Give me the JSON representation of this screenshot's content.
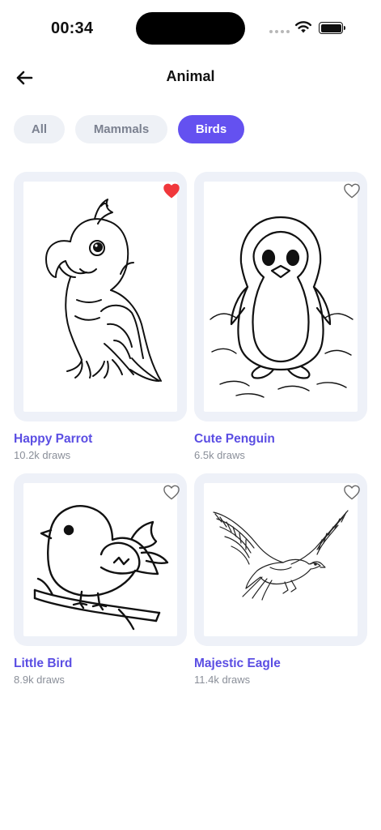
{
  "status": {
    "time": "00:34"
  },
  "header": {
    "title": "Animal"
  },
  "chips": [
    {
      "label": "All",
      "selected": false
    },
    {
      "label": "Mammals",
      "selected": false
    },
    {
      "label": "Birds",
      "selected": true
    }
  ],
  "cards": [
    {
      "title": "Happy Parrot",
      "draws": "10.2k draws",
      "favorite": true
    },
    {
      "title": "Cute Penguin",
      "draws": "6.5k draws",
      "favorite": false
    },
    {
      "title": "Little Bird",
      "draws": "8.9k draws",
      "favorite": false
    },
    {
      "title": "Majestic Eagle",
      "draws": "11.4k draws",
      "favorite": false
    }
  ],
  "colors": {
    "accent": "#6451f0",
    "title_text": "#5b4ee3",
    "heart_active": "#f0373b",
    "card_bg": "#eef1f8"
  },
  "icons": {
    "back": "arrow-left-icon",
    "favorite": "heart-icon"
  }
}
